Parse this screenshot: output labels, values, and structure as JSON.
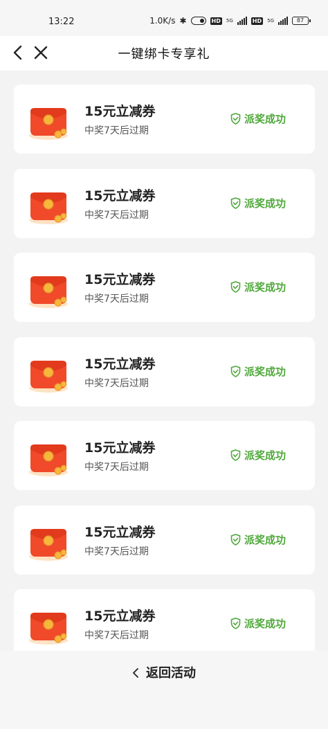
{
  "status_bar": {
    "time": "13:22",
    "net_speed": "1.0K/s",
    "net1": "5G",
    "net2": "5G",
    "battery": "87"
  },
  "header": {
    "title": "一键绑卡专享礼"
  },
  "rewards": [
    {
      "title": "15元立减券",
      "subtitle": "中奖7天后过期",
      "status": "派奖成功"
    },
    {
      "title": "15元立减券",
      "subtitle": "中奖7天后过期",
      "status": "派奖成功"
    },
    {
      "title": "15元立减券",
      "subtitle": "中奖7天后过期",
      "status": "派奖成功"
    },
    {
      "title": "15元立减券",
      "subtitle": "中奖7天后过期",
      "status": "派奖成功"
    },
    {
      "title": "15元立减券",
      "subtitle": "中奖7天后过期",
      "status": "派奖成功"
    },
    {
      "title": "15元立减券",
      "subtitle": "中奖7天后过期",
      "status": "派奖成功"
    },
    {
      "title": "15元立减券",
      "subtitle": "中奖7天后过期",
      "status": "派奖成功"
    }
  ],
  "footer": {
    "back_label": "返回活动"
  },
  "colors": {
    "success": "#4fa83a",
    "envelope": "#f04a2a",
    "coin": "#f6b73c"
  }
}
